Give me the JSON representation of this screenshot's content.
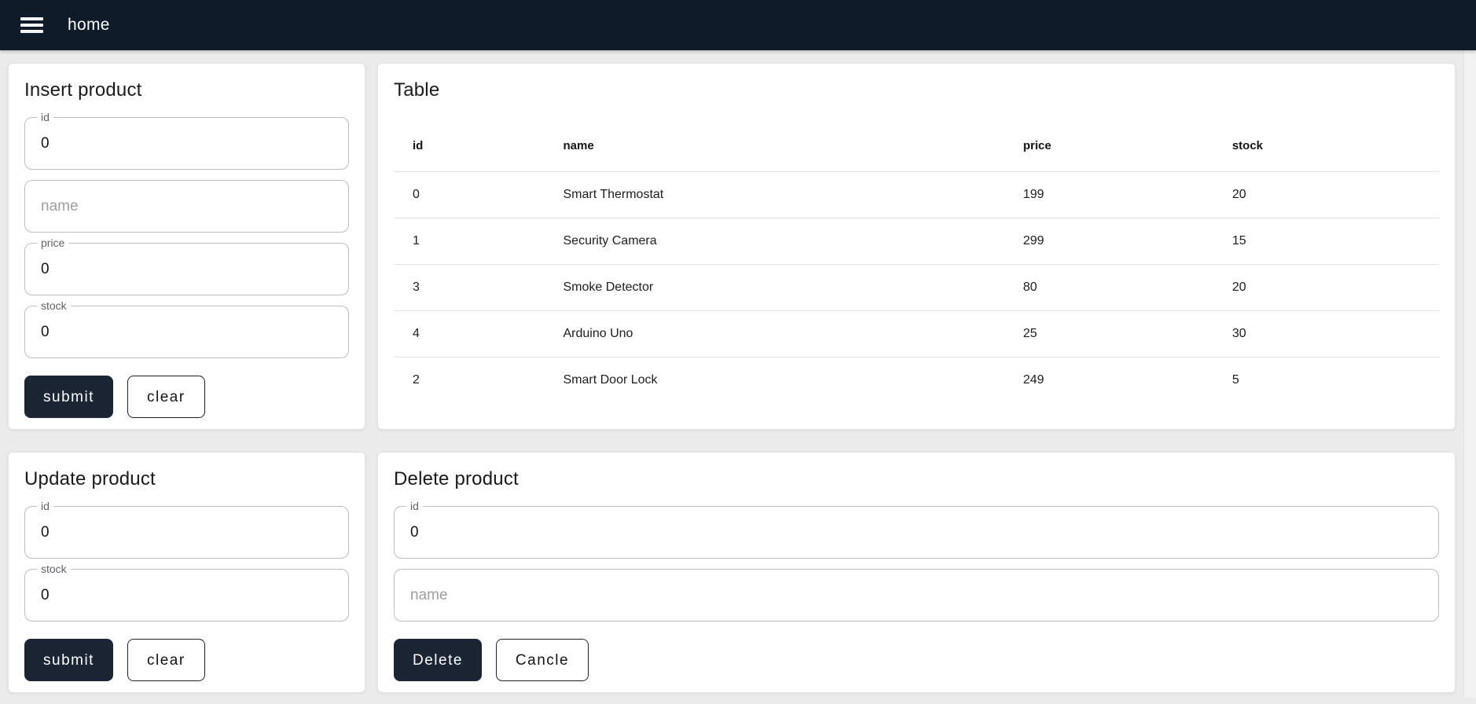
{
  "navbar": {
    "title": "home"
  },
  "colors": {
    "navbar_bg": "#101b29",
    "button_primary_bg": "#1b2535",
    "page_bg": "#ebebeb"
  },
  "insert_card": {
    "title": "Insert product",
    "fields": {
      "id": {
        "label": "id",
        "value": "0"
      },
      "name": {
        "placeholder": "name"
      },
      "price": {
        "label": "price",
        "value": "0"
      },
      "stock": {
        "label": "stock",
        "value": "0"
      }
    },
    "buttons": {
      "submit": "submit",
      "clear": "clear"
    }
  },
  "table_card": {
    "title": "Table",
    "columns": [
      "id",
      "name",
      "price",
      "stock"
    ],
    "rows": [
      {
        "id": "0",
        "name": "Smart Thermostat",
        "price": "199",
        "stock": "20"
      },
      {
        "id": "1",
        "name": "Security Camera",
        "price": "299",
        "stock": "15"
      },
      {
        "id": "3",
        "name": "Smoke Detector",
        "price": "80",
        "stock": "20"
      },
      {
        "id": "4",
        "name": "Arduino Uno",
        "price": "25",
        "stock": "30"
      },
      {
        "id": "2",
        "name": "Smart Door Lock",
        "price": "249",
        "stock": "5"
      }
    ]
  },
  "update_card": {
    "title": "Update product",
    "fields": {
      "id": {
        "label": "id",
        "value": "0"
      },
      "stock": {
        "label": "stock",
        "value": "0"
      }
    },
    "buttons": {
      "submit": "submit",
      "clear": "clear"
    }
  },
  "delete_card": {
    "title": "Delete product",
    "fields": {
      "id": {
        "label": "id",
        "value": "0"
      },
      "name": {
        "placeholder": "name"
      }
    },
    "buttons": {
      "delete": "Delete",
      "cancel": "Cancle"
    }
  }
}
